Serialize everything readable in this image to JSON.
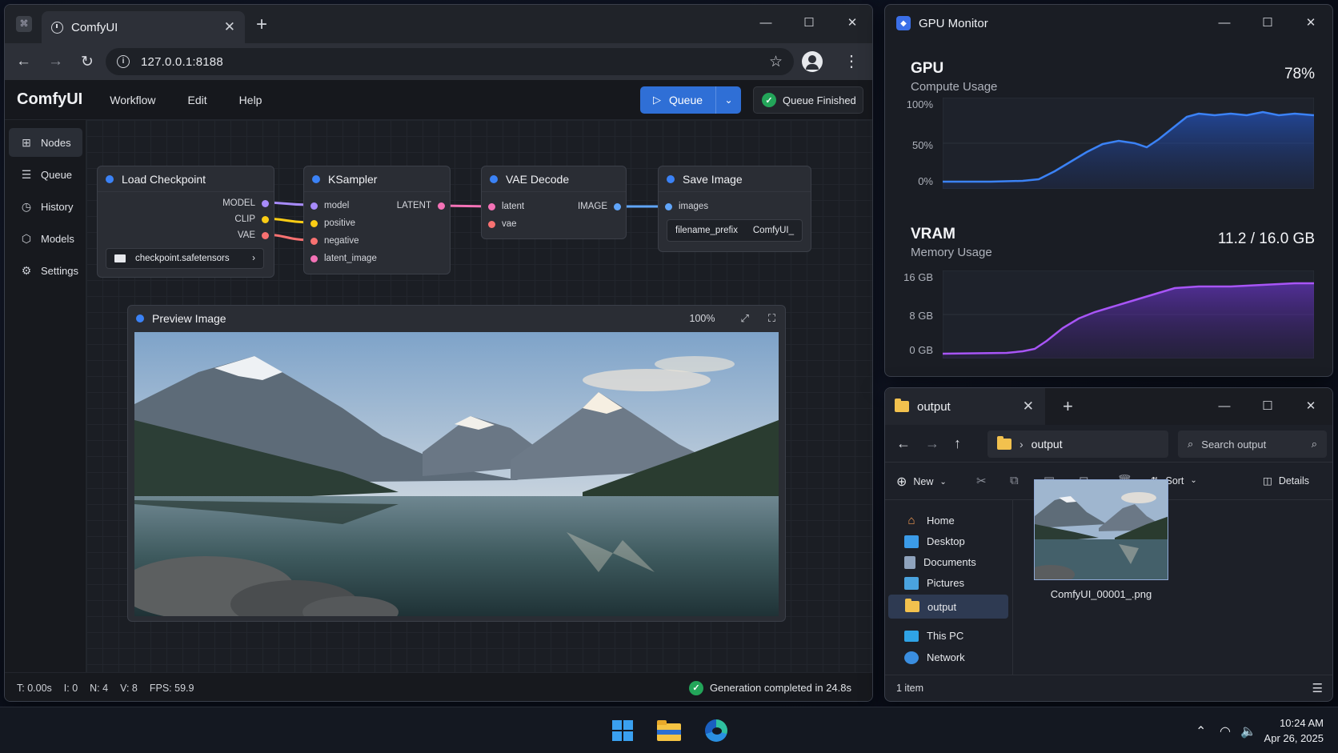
{
  "browser": {
    "tab_title": "ComfyUI",
    "url": "127.0.0.1:8188"
  },
  "comfy": {
    "brand": "ComfyUI",
    "menu": [
      "Workflow",
      "Edit",
      "Help"
    ],
    "queue_button": "Queue",
    "queue_status": "Queue Finished",
    "sidebar": [
      {
        "label": "Nodes",
        "icon": "grid-icon",
        "active": true
      },
      {
        "label": "Queue",
        "icon": "queue-icon"
      },
      {
        "label": "History",
        "icon": "history-icon"
      },
      {
        "label": "Models",
        "icon": "cube-icon"
      },
      {
        "label": "Settings",
        "icon": "gear-icon"
      }
    ],
    "nodes": {
      "load_checkpoint": {
        "title": "Load Checkpoint",
        "outputs": [
          "MODEL",
          "CLIP",
          "VAE"
        ],
        "ckpt": "checkpoint.safetensors"
      },
      "ksampler": {
        "title": "KSampler",
        "inputs": [
          "model",
          "positive",
          "negative",
          "latent_image"
        ],
        "output": "LATENT"
      },
      "vae_decode": {
        "title": "VAE Decode",
        "inputs": [
          "latent",
          "vae"
        ],
        "output": "IMAGE"
      },
      "save_image": {
        "title": "Save Image",
        "input": "images",
        "field_label": "filename_prefix",
        "field_value": "ComfyUI_"
      },
      "preview": {
        "title": "Preview Image",
        "zoom": "100%"
      }
    },
    "status": {
      "t": "T: 0.00s",
      "i": "I: 0",
      "n": "N: 4",
      "v": "V: 8",
      "fps": "FPS: 59.9",
      "done": "Generation completed in 24.8s"
    },
    "colors": {
      "model": "#a78bfa",
      "clip": "#facc15",
      "vae": "#f87171",
      "latent": "#f472b6",
      "image": "#60a5fa",
      "accent": "#2f6fd6"
    }
  },
  "gpu_monitor": {
    "title": "GPU Monitor",
    "gpu": {
      "label": "GPU",
      "sub": "Compute Usage",
      "value": "78%",
      "ticks": [
        "100%",
        "50%",
        "0%"
      ]
    },
    "vram": {
      "label": "VRAM",
      "sub": "Memory Usage",
      "value": "11.2 / 16.0 GB",
      "ticks": [
        "16 GB",
        "8 GB",
        "0 GB"
      ]
    }
  },
  "explorer": {
    "tab": "output",
    "breadcrumb": "output",
    "search_placeholder": "Search output",
    "toolbar": {
      "new": "New",
      "sort": "Sort",
      "details": "Details"
    },
    "tree": [
      "Home",
      "Desktop",
      "Documents",
      "Pictures",
      "output",
      "This PC",
      "Network"
    ],
    "file": "ComfyUI_00001_.png",
    "status": "1 item"
  },
  "taskbar": {
    "time": "10:24 AM",
    "date": "Apr 26, 2025"
  }
}
